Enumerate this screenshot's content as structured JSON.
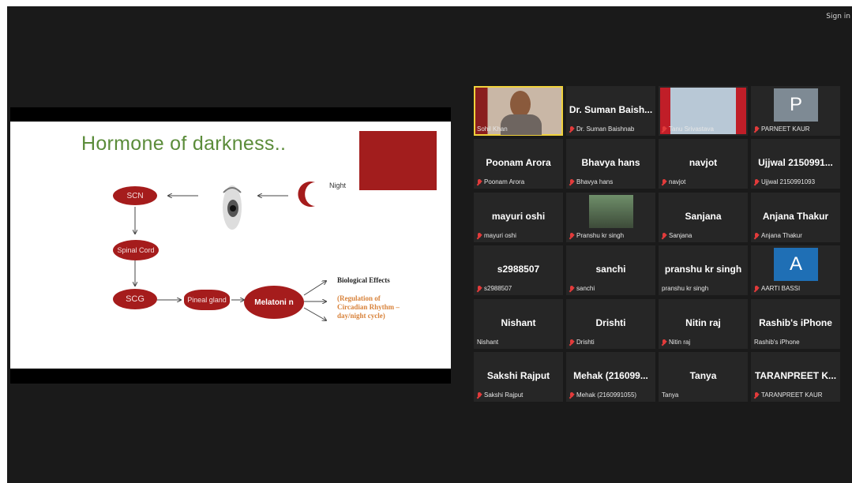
{
  "header": {
    "sign_in": "Sign in"
  },
  "slide": {
    "title": "Hormone of darkness..",
    "nodes": {
      "night": "Night",
      "scn": "SCN",
      "spinal": "Spinal Cord",
      "scg": "SCG",
      "pineal": "Pineal gland",
      "melatonin": "Melatoni n"
    },
    "bio_title": "Biological Effects",
    "bio_detail": "(Regulation of Circadian Rhythm – day/night cycle)"
  },
  "participants": [
    {
      "big": "",
      "label": "Sohil Khan",
      "video": true,
      "muted": false,
      "active": true
    },
    {
      "big": "Dr. Suman Baish...",
      "label": "Dr. Suman Baishnab",
      "muted": true
    },
    {
      "big": "",
      "label": "Tanu Srivastava",
      "video": true,
      "muted": true
    },
    {
      "big": "P",
      "label": "PARNEET KAUR",
      "avatar": true,
      "avatar_color": "#7e8a94",
      "muted": true
    },
    {
      "big": "Poonam Arora",
      "label": "Poonam Arora",
      "muted": true
    },
    {
      "big": "Bhavya hans",
      "label": "Bhavya hans",
      "muted": true
    },
    {
      "big": "navjot",
      "label": "navjot",
      "muted": true
    },
    {
      "big": "Ujjwal 2150991...",
      "label": "Ujjwal 2150991093",
      "muted": true
    },
    {
      "big": "mayuri oshi",
      "label": "mayuri oshi",
      "muted": true
    },
    {
      "big": "",
      "label": "Pranshu kr singh",
      "photo": true,
      "muted": true
    },
    {
      "big": "Sanjana",
      "label": "Sanjana",
      "muted": true
    },
    {
      "big": "Anjana Thakur",
      "label": "Anjana Thakur",
      "muted": true
    },
    {
      "big": "s2988507",
      "label": "s2988507",
      "muted": true
    },
    {
      "big": "sanchi",
      "label": "sanchi",
      "muted": true
    },
    {
      "big": "pranshu kr singh",
      "label": "pranshu kr singh",
      "muted": false
    },
    {
      "big": "A",
      "label": "AARTI BASSI",
      "avatar": true,
      "avatar_color": "#1f6fb5",
      "muted": true
    },
    {
      "big": "Nishant",
      "label": "Nishant",
      "muted": false
    },
    {
      "big": "Drishti",
      "label": "Drishti",
      "muted": true
    },
    {
      "big": "Nitin raj",
      "label": "Nitin raj",
      "muted": true
    },
    {
      "big": "Rashib's iPhone",
      "label": "Rashib's iPhone",
      "muted": false
    },
    {
      "big": "Sakshi Rajput",
      "label": "Sakshi Rajput",
      "muted": true
    },
    {
      "big": "Mehak (216099...",
      "label": "Mehak (2160991055)",
      "muted": true
    },
    {
      "big": "Tanya",
      "label": "Tanya",
      "muted": false
    },
    {
      "big": "TARANPREET K...",
      "label": "TARANPREET KAUR",
      "muted": true
    }
  ]
}
